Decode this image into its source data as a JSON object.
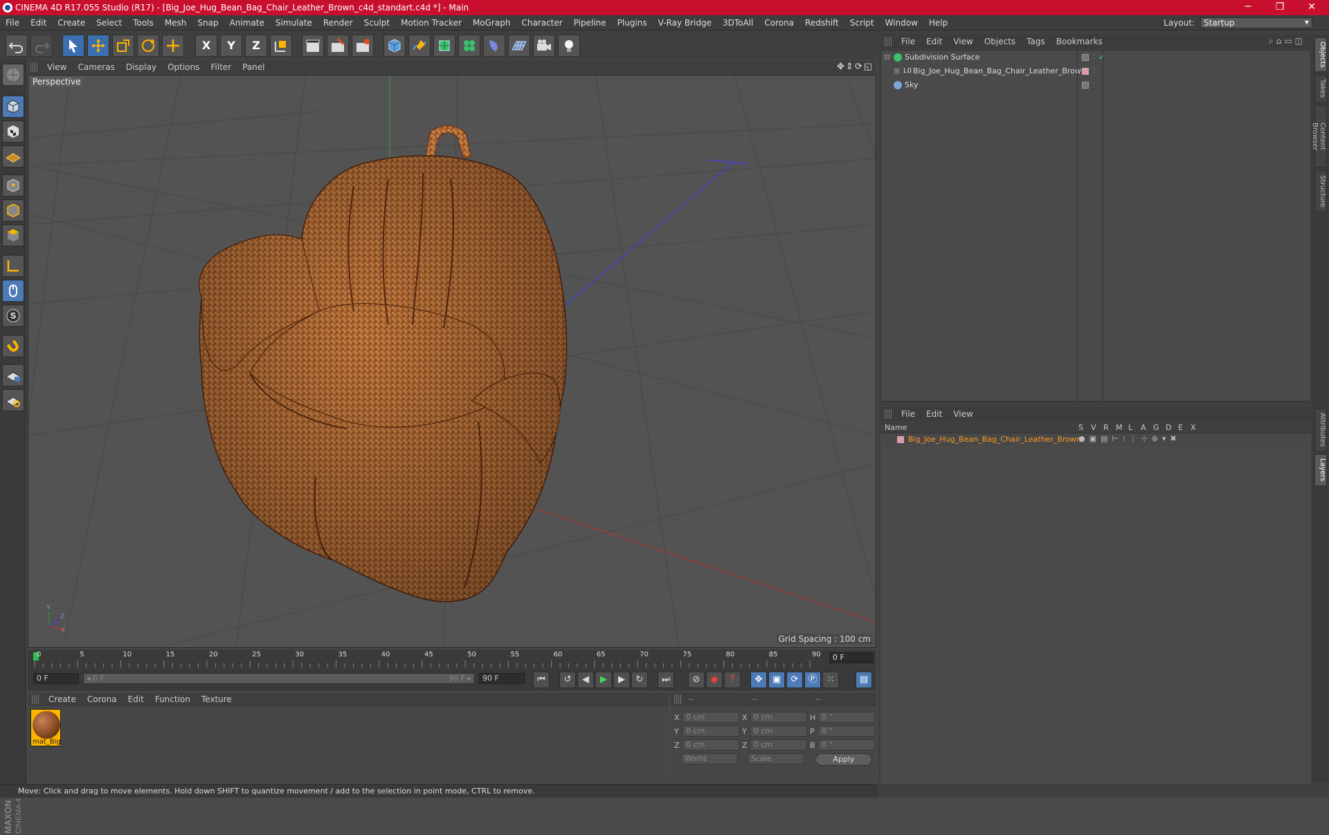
{
  "window": {
    "title": "CINEMA 4D R17.055 Studio (R17) - [Big_Joe_Hug_Bean_Bag_Chair_Leather_Brown_c4d_standart.c4d *] - Main",
    "minimize": "─",
    "maximize": "❐",
    "close": "✕"
  },
  "menubar": {
    "items": [
      "File",
      "Edit",
      "Create",
      "Select",
      "Tools",
      "Mesh",
      "Snap",
      "Animate",
      "Simulate",
      "Render",
      "Sculpt",
      "Motion Tracker",
      "MoGraph",
      "Character",
      "Pipeline",
      "Plugins",
      "V-Ray Bridge",
      "3DToAll",
      "Corona",
      "Redshift",
      "Script",
      "Window",
      "Help"
    ],
    "layout_label": "Layout:",
    "layout_value": "Startup"
  },
  "toolbar": {
    "axis_x": "X",
    "axis_y": "Y",
    "axis_z": "Z"
  },
  "viewport": {
    "menu": [
      "View",
      "Cameras",
      "Display",
      "Options",
      "Filter",
      "Panel"
    ],
    "nav_icons": "✥⇕⟳◱",
    "label": "Perspective",
    "grid_spacing": "Grid Spacing : 100 cm",
    "axis_labels": {
      "y": "Y",
      "z": "Z",
      "x": "X"
    }
  },
  "timeline": {
    "ticks": [
      "0",
      "5",
      "10",
      "15",
      "20",
      "25",
      "30",
      "35",
      "40",
      "45",
      "50",
      "55",
      "60",
      "65",
      "70",
      "75",
      "80",
      "85",
      "90"
    ],
    "current_frame": "0 F",
    "start_field": "0 F",
    "range_start": "◂ 0 F",
    "range_end": "90 F ▸",
    "end_field": "90 F"
  },
  "material_manager": {
    "menu": [
      "Create",
      "Corona",
      "Edit",
      "Function",
      "Texture"
    ],
    "material_name": "mat_Big"
  },
  "coordinates": {
    "header_1": "--",
    "header_2": "--",
    "header_3": "--",
    "rows": [
      {
        "l1": "X",
        "v1": "0 cm",
        "l2": "X",
        "v2": "0 cm",
        "l3": "H",
        "v3": "0 °"
      },
      {
        "l1": "Y",
        "v1": "0 cm",
        "l2": "Y",
        "v2": "0 cm",
        "l3": "P",
        "v3": "0 °"
      },
      {
        "l1": "Z",
        "v1": "0 cm",
        "l2": "Z",
        "v2": "0 cm",
        "l3": "B",
        "v3": "0 °"
      }
    ],
    "world": "World",
    "scale": "Scale",
    "apply": "Apply"
  },
  "object_manager": {
    "menu": [
      "File",
      "Edit",
      "View",
      "Objects",
      "Tags",
      "Bookmarks"
    ],
    "objects": [
      {
        "name": "Subdivision Surface"
      },
      {
        "name": "Big_Joe_Hug_Bean_Bag_Chair_Leather_Brown"
      },
      {
        "name": "Sky"
      }
    ]
  },
  "layer_manager": {
    "menu": [
      "File",
      "Edit",
      "View"
    ],
    "columns": [
      "Name",
      "S",
      "V",
      "R",
      "M",
      "L",
      "A",
      "G",
      "D",
      "E",
      "X"
    ],
    "layer_name": "Big_Joe_Hug_Bean_Bag_Chair_Leather_Brown"
  },
  "side_tabs": [
    "Objects",
    "Takes",
    "Content Browser",
    "Structure",
    "Attributes",
    "Layers"
  ],
  "status": {
    "text": "Move: Click and drag to move elements. Hold down SHIFT to quantize movement / add to the selection in point mode, CTRL to remove."
  },
  "colors": {
    "accent": "#c8102e",
    "layer_name": "#ff9a1f",
    "selection_blue": "#4d7bb8"
  }
}
